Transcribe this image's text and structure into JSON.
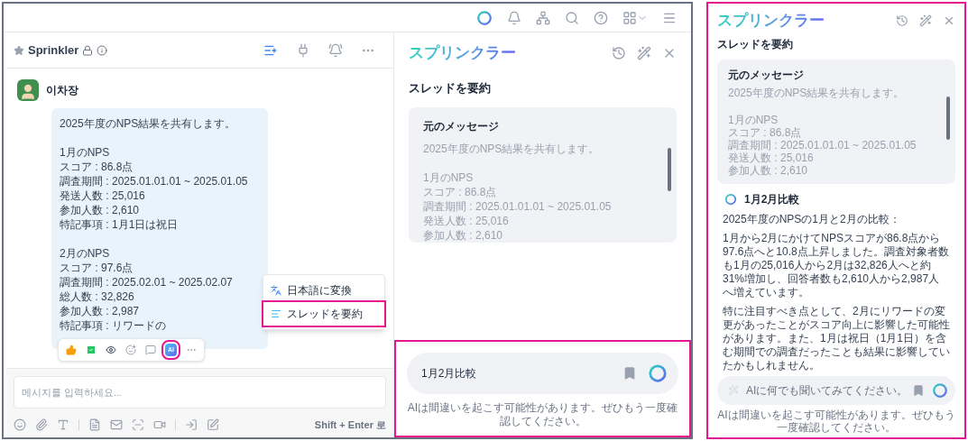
{
  "chat": {
    "channel_name": "Sprinkler",
    "sender": "이차장",
    "message": [
      [
        "2025年度のNPS結果を共有します。"
      ],
      [
        "1月のNPS",
        "スコア : 86.8点",
        "調査期間 : 2025.01.01.01 ~ 2025.01.05",
        "発送人数 : 25,016",
        "参加人数 : 2,610",
        "特記事項 : 1月1日は祝日"
      ],
      [
        "2月のNPS",
        "スコア : 97.6点",
        "調査期間 : 2025.02.01 ~ 2025.02.07",
        "総人数 : 32,826",
        "参加人数 : 2,987",
        "特記事項 : リワードの"
      ]
    ],
    "ai_button": {
      "label": "AI",
      "highlighted": true
    },
    "context_menu": [
      {
        "kind": "translate",
        "label": "日本語に変換",
        "highlighted": false
      },
      {
        "kind": "summary",
        "label": "スレッドを要約",
        "highlighted": true
      }
    ],
    "input": {
      "placeholder": "메시지를 입력하세요..."
    },
    "hint": "Shift + Enter 로"
  },
  "ai_panel": {
    "logo": "スプリンクラー",
    "title": "スレッドを要約",
    "source_label": "元のメッセージ",
    "source": [
      [
        "2025年度のNPS結果を共有します。"
      ],
      [
        "1月のNPS",
        "スコア : 86.8点",
        "調査期間 : 2025.01.01.01 ~ 2025.01.05",
        "発送人数 : 25,016",
        "参加人数 : 2,610"
      ]
    ],
    "prompt": {
      "value": "1月2月比較"
    },
    "highlighted": true,
    "disclaimer": "AIは間違いを起こす可能性があります。ぜひもう一度確認してください。"
  },
  "ai_panel_result": {
    "logo": "スプリンクラー",
    "title": "スレッドを要約",
    "source_label": "元のメッセージ",
    "source": [
      [
        "2025年度のNPS結果を共有します。"
      ],
      [
        "1月のNPS",
        "スコア : 86.8点",
        "調査期間 : 2025.01.01.01 ~ 2025.01.05",
        "発送人数 : 25,016",
        "参加人数 : 2,610"
      ]
    ],
    "result_heading": "1月2月比較",
    "result": [
      "2025年度のNPSの1月と2月の比較：",
      "1月から2月にかけてNPSスコアが86.8点から97.6点へと10.8点上昇しました。調査対象者数も1月の25,016人から2月は32,826人へと約31%増加し、回答者数も2,610人から2,987人へ増えています。",
      "特に注目すべき点として、2月にリワードの変更があったことがスコア向上に影響した可能性があります。また、1月は祝日（1月1日）を含む期間での調査だったことも結果に影響していたかもしれません。"
    ],
    "prompt": {
      "placeholder": "AIに何でも聞いてみてください。"
    },
    "highlighted": true,
    "disclaimer": "AIは間違いを起こす可能性があります。ぜひもう一度確認してください。"
  }
}
